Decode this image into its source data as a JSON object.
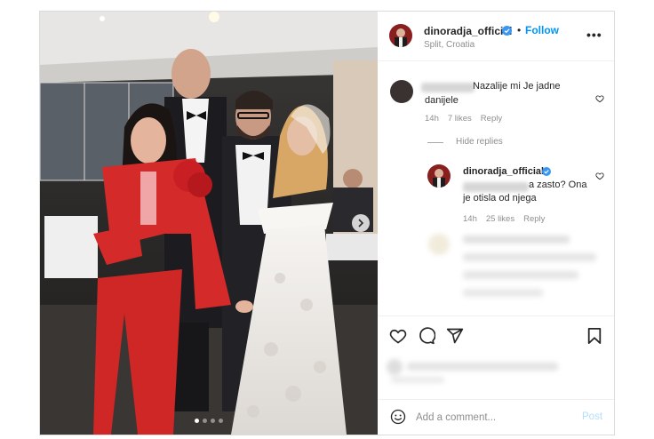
{
  "post": {
    "username": "dinoradja_official",
    "follow_separator": "•",
    "follow_label": "Follow",
    "location": "Split, Croatia",
    "more_label": "•••",
    "carousel": {
      "slides": 4,
      "active_index": 0
    }
  },
  "comments": [
    {
      "text": "Nazalije mi Je jadne danijele",
      "time": "14h",
      "likes": "7 likes",
      "reply_label": "Reply"
    }
  ],
  "replies_toggle": "Hide replies",
  "replies": [
    {
      "username": "dinoradja_official",
      "text": "a zasto? Ona je otisla od njega",
      "time": "14h",
      "likes": "25 likes",
      "reply_label": "Reply"
    }
  ],
  "add_comment": {
    "placeholder": "Add a comment...",
    "post_label": "Post"
  },
  "colors": {
    "link_blue": "#0095f6",
    "post_disabled": "#b2dffc",
    "muted": "#8e8e8e",
    "text": "#262626",
    "border": "#dbdbdb"
  },
  "icons": [
    "verified-badge-icon",
    "heart-icon",
    "comment-icon",
    "share-icon",
    "save-icon",
    "emoji-icon",
    "chevron-right-icon",
    "more-icon"
  ]
}
